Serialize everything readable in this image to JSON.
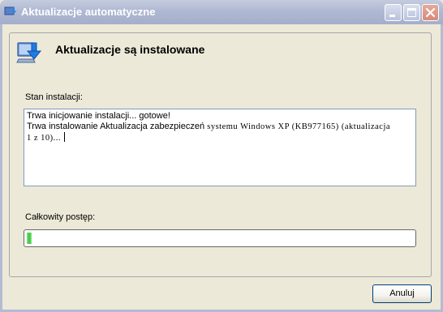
{
  "window": {
    "title": "Aktualizacje automatyczne",
    "title_icon": "windows-update-shield-icon"
  },
  "header": {
    "title": "Aktualizacje są instalowane",
    "icon": "windows-update-icon"
  },
  "status": {
    "label": "Stan instalacji:",
    "log_line_1": "Trwa inicjowanie instalacji... gotowe!",
    "log_line_2_sans": "Trwa instalowanie Aktualizacja zabezpieczeń",
    "log_line_2_mono": " systemu Windows XP (KB977165) (aktualizacja",
    "log_line_3": "1 z 10)..."
  },
  "progress": {
    "label": "Całkowity postęp:",
    "value_percent": 1
  },
  "buttons": {
    "cancel_label": "Anuluj"
  },
  "colors": {
    "accent_progress": "#33c633",
    "window_background": "#ece9d8",
    "titlebar_inactive": "#b0b9d3"
  }
}
